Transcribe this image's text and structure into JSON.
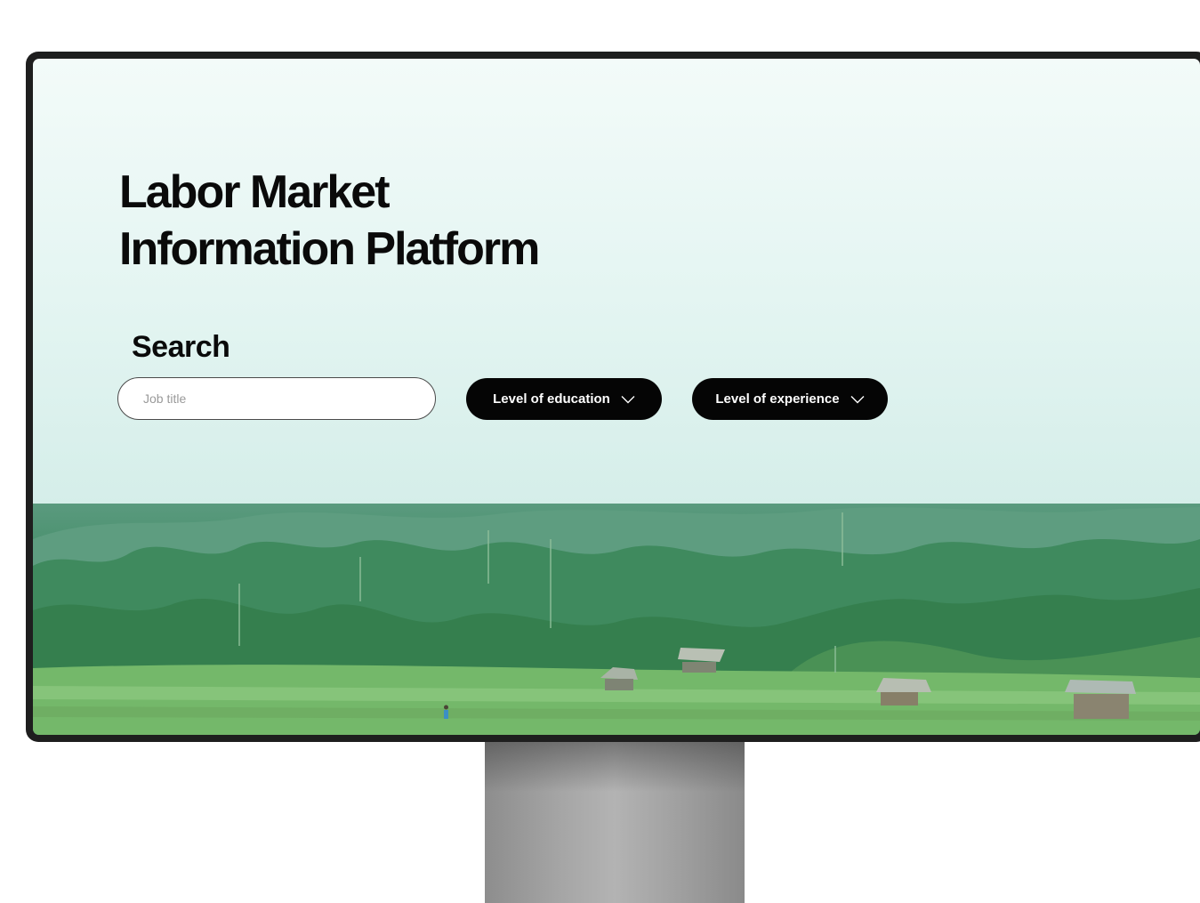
{
  "hero": {
    "title_line1": "Labor Market",
    "title_line2": "Information Platform"
  },
  "search": {
    "heading": "Search",
    "job_title_placeholder": "Job title",
    "job_title_value": ""
  },
  "filters": {
    "education_label": "Level of education",
    "experience_label": "Level of experience"
  },
  "icons": {
    "dropdown": "chevron-down-icon"
  },
  "colors": {
    "button_bg": "#050505",
    "button_text": "#ffffff",
    "background_top": "#f3fbf9",
    "background_bottom": "#cfeae5",
    "forest": "#3f8a63"
  }
}
